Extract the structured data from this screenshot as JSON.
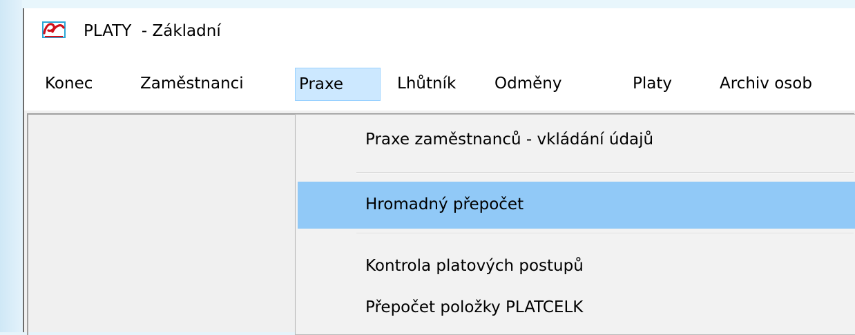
{
  "window": {
    "title": "PLATY  - Základní",
    "icon": "app-logo-icon"
  },
  "menubar": {
    "items": [
      {
        "label": "Konec"
      },
      {
        "label": "Zaměstnanci"
      },
      {
        "label": "Praxe",
        "open": true
      },
      {
        "label": "Lhůtník"
      },
      {
        "label": "Odměny"
      },
      {
        "label": "Platy"
      },
      {
        "label": "Archiv osob"
      }
    ]
  },
  "dropdown": {
    "items": [
      {
        "label": "Praxe zaměstnanců - vkládání údajů"
      },
      {
        "label": "Hromadný přepočet",
        "highlighted": true
      },
      {
        "label": "Kontrola platových postupů"
      },
      {
        "label": "Přepočet položky PLATCELK"
      }
    ]
  },
  "colors": {
    "menu_open_bg": "#cce8ff",
    "menu_highlight_bg": "#91c9f7",
    "desktop_bg": "#e6f4fb"
  }
}
